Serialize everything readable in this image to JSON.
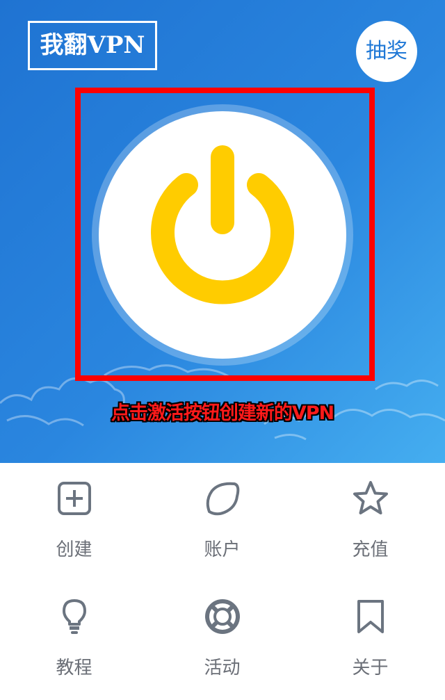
{
  "header": {
    "logo_text": "我翻VPN",
    "lottery_button": "抽奖"
  },
  "main": {
    "power_button_icon": "power-icon",
    "hint_text": "点击激活按钮创建新的VPN"
  },
  "colors": {
    "hero": "#2a86df",
    "power": "#ffcc00",
    "highlight": "#ff0000",
    "menu_icon": "#6b7480",
    "menu_text": "#6b6f77"
  },
  "menu": {
    "items": [
      {
        "label": "创建",
        "icon": "plus-square-icon"
      },
      {
        "label": "账户",
        "icon": "lemon-icon"
      },
      {
        "label": "充值",
        "icon": "star-icon"
      },
      {
        "label": "教程",
        "icon": "lightbulb-icon"
      },
      {
        "label": "活动",
        "icon": "lifebuoy-icon"
      },
      {
        "label": "关于",
        "icon": "bookmark-icon"
      }
    ]
  }
}
